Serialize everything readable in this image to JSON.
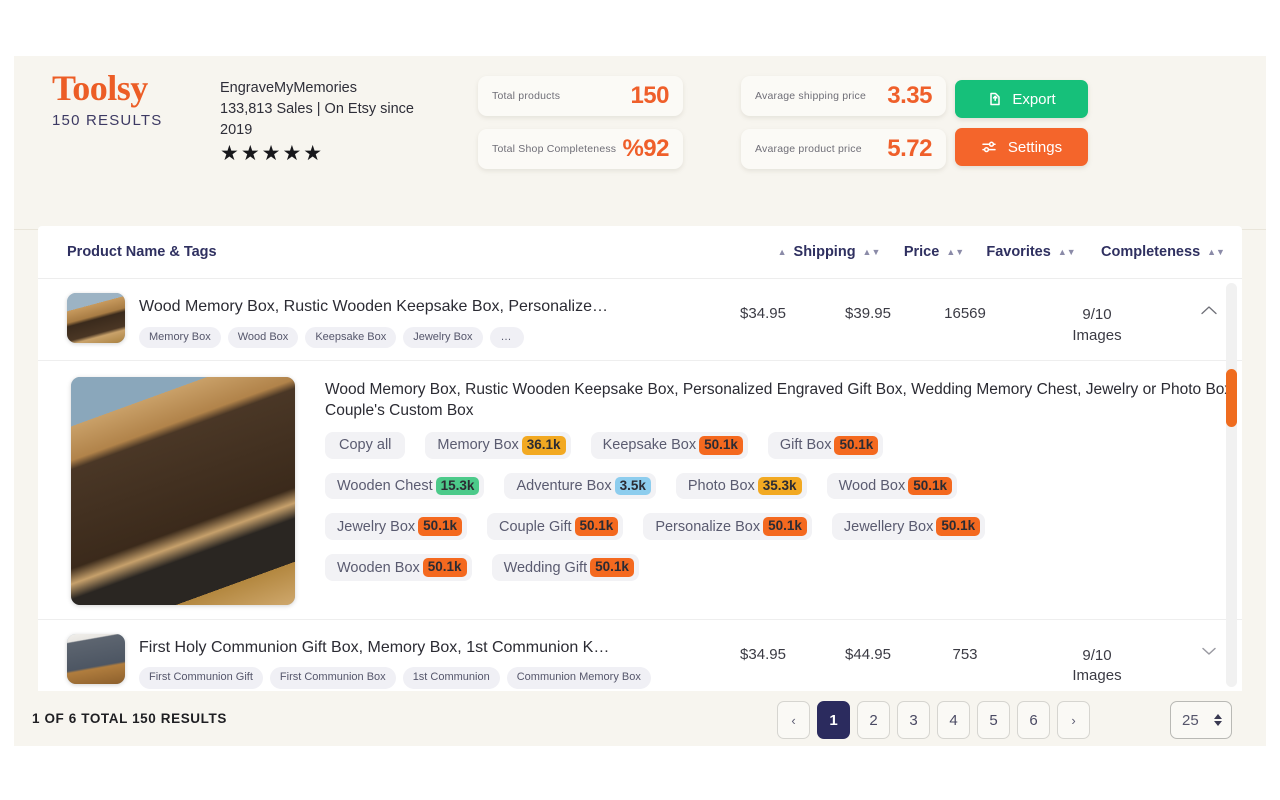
{
  "brand": {
    "name": "Toolsy",
    "subtitle": "150 RESULTS"
  },
  "shop": {
    "name": "EngraveMyMemories",
    "meta": "133,813 Sales | On Etsy since 2019",
    "stars": "★★★★★"
  },
  "stats": [
    {
      "label": "Total products",
      "value": "150"
    },
    {
      "label": "Total Shop Completeness",
      "value": "%92"
    },
    {
      "label": "Avarage shipping price",
      "value": "3.35"
    },
    {
      "label": "Avarage product price",
      "value": "5.72"
    }
  ],
  "actions": {
    "export": {
      "label": "Export",
      "icon": "export-icon",
      "color": "#16c07a"
    },
    "settings": {
      "label": "Settings",
      "icon": "sliders-icon",
      "color": "#f4652b"
    }
  },
  "table": {
    "columns": {
      "name": "Product Name & Tags",
      "shipping": "Shipping",
      "price": "Price",
      "favorites": "Favorites",
      "completeness": "Completeness"
    },
    "rows": [
      {
        "title": "Wood Memory Box, Rustic Wooden Keepsake Box, Personalize…",
        "tags": [
          "Memory Box",
          "Wood Box",
          "Keepsake Box",
          "Jewelry Box",
          "…"
        ],
        "shipping": "$34.95",
        "price": "$39.95",
        "favorites": "16569",
        "completeness_count": "9/10",
        "completeness_unit": "Images",
        "expand_icon": "chevron-up-icon"
      },
      {
        "title": "Wood Memory Box, Rustic Wooden Keepsake Box, Personalized Engraved Gift Box, Wedding Memory Chest, Jewelry or Photo Box, Couple's Custom Box",
        "copy_all": "Copy all",
        "tags": [
          {
            "label": "Memory Box",
            "count": "36.1k",
            "color": "#f2a922"
          },
          {
            "label": "Keepsake Box",
            "count": "50.1k",
            "color": "#f4691f"
          },
          {
            "label": "Gift Box",
            "count": "50.1k",
            "color": "#f4691f"
          },
          {
            "label": "Wooden Chest",
            "count": "15.3k",
            "color": "#4cca8a"
          },
          {
            "label": "Adventure Box",
            "count": "3.5k",
            "color": "#8dcdee"
          },
          {
            "label": "Photo Box",
            "count": "35.3k",
            "color": "#f2a922"
          },
          {
            "label": "Wood Box",
            "count": "50.1k",
            "color": "#f4691f"
          },
          {
            "label": "Jewelry Box",
            "count": "50.1k",
            "color": "#f4691f"
          },
          {
            "label": "Couple Gift",
            "count": "50.1k",
            "color": "#f4691f"
          },
          {
            "label": "Personalize Box",
            "count": "50.1k",
            "color": "#f4691f"
          },
          {
            "label": "Jewellery Box",
            "count": "50.1k",
            "color": "#f4691f"
          },
          {
            "label": "Wooden Box",
            "count": "50.1k",
            "color": "#f4691f"
          },
          {
            "label": "Wedding Gift",
            "count": "50.1k",
            "color": "#f4691f"
          }
        ]
      },
      {
        "title": "First Holy Communion Gift Box, Memory Box, 1st Communion K…",
        "tags": [
          "First Communion Gift",
          "First Communion Box",
          "1st Communion",
          "Communion Memory Box"
        ],
        "shipping": "$34.95",
        "price": "$44.95",
        "favorites": "753",
        "completeness_count": "9/10",
        "completeness_unit": "Images",
        "expand_icon": "chevron-down-icon"
      }
    ]
  },
  "footer": {
    "count_text": "1 OF 6 TOTAL 150 RESULTS",
    "pager": {
      "prev": "‹",
      "pages": [
        "1",
        "2",
        "3",
        "4",
        "5",
        "6"
      ],
      "next": "›",
      "active": "1"
    },
    "page_size": "25"
  },
  "colors": {
    "accent_orange": "#ef5f2a",
    "navy": "#2b2b5e",
    "green": "#16c07a",
    "panel_bg": "#f7f5ef"
  }
}
